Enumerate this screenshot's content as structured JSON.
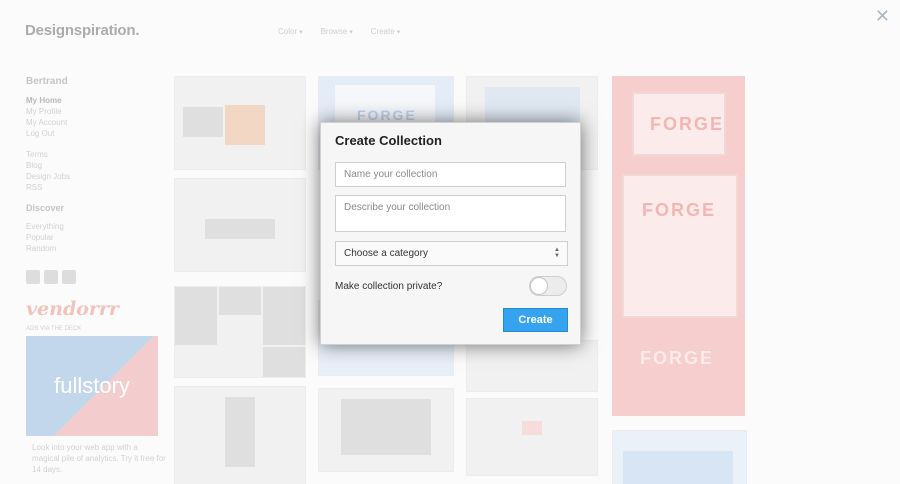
{
  "site": {
    "logo": "Designspiration."
  },
  "topnav": {
    "items": [
      "Color",
      "Browse",
      "Create"
    ]
  },
  "sidebar": {
    "username": "Bertrand",
    "account_links": [
      "My Home",
      "My Profile",
      "My Account",
      "Log Out"
    ],
    "info_links": [
      "Terms",
      "Blog",
      "Design Jobs",
      "RSS"
    ],
    "discover_heading": "Discover",
    "discover_links": [
      "Everything",
      "Popular",
      "Random"
    ],
    "sponsor_logo": "vendorrr",
    "ad_label": "ADS VIA THE DECK",
    "ad_brand": "fullstory",
    "ad_text": "Look into your web app with a magical pile of analytics. Try it free for 14 days."
  },
  "thumbnails": {
    "forge_text": "FORGE"
  },
  "modal": {
    "title": "Create Collection",
    "name_placeholder": "Name your collection",
    "description_placeholder": "Describe your collection",
    "category_selected": "Choose a category",
    "private_label": "Make collection private?",
    "private_enabled": false,
    "create_label": "Create",
    "accent_color": "#36a3f0"
  },
  "icons": {
    "close": "close-icon"
  }
}
